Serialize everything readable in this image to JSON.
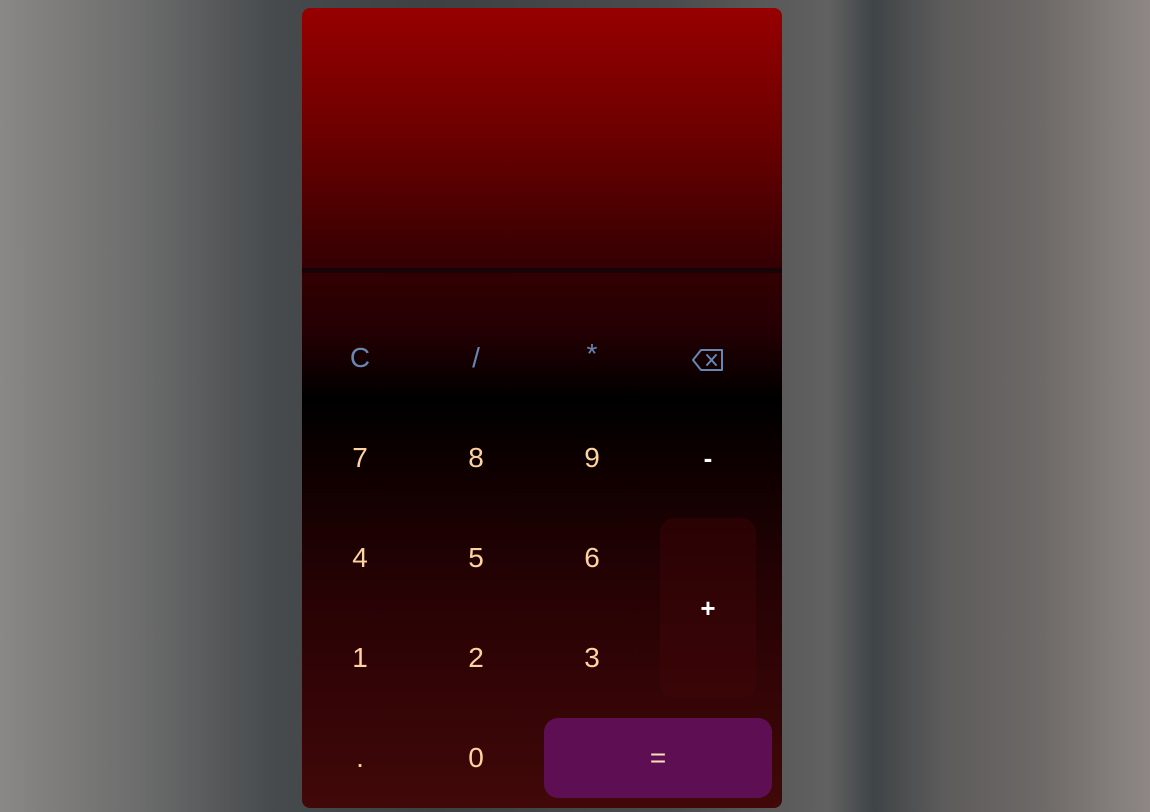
{
  "display": {
    "previous": "",
    "current": ""
  },
  "buttons": {
    "clear": "C",
    "divide": "/",
    "multiply": "*",
    "backspace": "⌫",
    "seven": "7",
    "eight": "8",
    "nine": "9",
    "minus": "-",
    "four": "4",
    "five": "5",
    "six": "6",
    "plus": "+",
    "one": "1",
    "two": "2",
    "three": "3",
    "decimal": ".",
    "zero": "0",
    "equals": "="
  },
  "colors": {
    "digit_text": "#ffd3a0",
    "operator_top_text": "#6886b4",
    "operator_side_text": "#ffffff",
    "equals_bg": "#5e0f54",
    "display_top": "#970000"
  }
}
